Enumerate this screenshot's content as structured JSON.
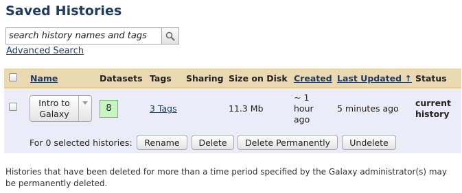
{
  "page": {
    "title": "Saved Histories"
  },
  "search": {
    "placeholder": "search history names and tags",
    "icon": "search-icon",
    "advanced_label": "Advanced Search"
  },
  "grid": {
    "columns": [
      {
        "label": "Name",
        "link": true
      },
      {
        "label": "Datasets",
        "link": false
      },
      {
        "label": "Tags",
        "link": false
      },
      {
        "label": "Sharing",
        "link": false
      },
      {
        "label": "Size on Disk",
        "link": false
      },
      {
        "label": "Created",
        "link": true
      },
      {
        "label": "Last Updated ↑",
        "link": true
      },
      {
        "label": "Status",
        "link": false
      }
    ],
    "rows": [
      {
        "name": "Intro to Galaxy",
        "datasets": "8",
        "tags": "3 Tags",
        "sharing": "",
        "size": "11.3 Mb",
        "created": "~ 1 hour ago",
        "updated": "5 minutes ago",
        "status": "current history",
        "dataset_badge_color": "#c7f6c1"
      }
    ],
    "operations": {
      "label": "For 0 selected histories:",
      "buttons": [
        "Rename",
        "Delete",
        "Delete Permanently",
        "Undelete"
      ]
    }
  },
  "footnote": "Histories that have been deleted for more than a time period specified by the Galaxy administrator(s) may be permanently deleted.",
  "colors": {
    "title": "#1d3b61",
    "header_bg": "#ebd9b2",
    "row_bg": "#ececf9",
    "link": "#1d3b61"
  }
}
